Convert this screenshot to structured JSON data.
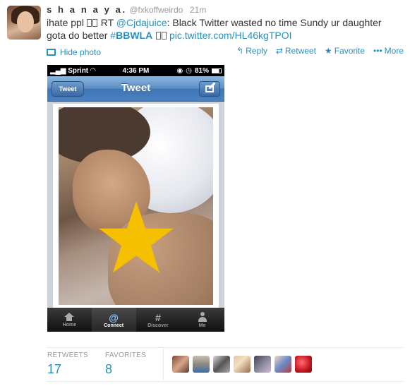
{
  "tweet": {
    "fullname": "s h a n a y a.",
    "handle": "@fxkoffweirdo",
    "time": "21m",
    "text_pre": "ihate ppl",
    "text_rt": "RT",
    "mention": "@Cjdajuice",
    "text_body": ": Black Twitter wasted no time Sundy ur daughter gota do better ",
    "hashtag_prefix": "#",
    "hashtag": "BBWLA",
    "link": "pic.twitter.com/HL46kgTPOI"
  },
  "actions": {
    "hide_photo": "Hide photo",
    "reply": "Reply",
    "retweet": "Retweet",
    "favorite": "Favorite",
    "more": "More"
  },
  "phone": {
    "carrier": "Sprint",
    "time": "4:36 PM",
    "battery": "81%",
    "nav_title": "Tweet",
    "back_label": "Tweet",
    "tabs": [
      {
        "label": "Home",
        "icon": "home-icon"
      },
      {
        "label": "Connect",
        "icon": "at-sign-icon"
      },
      {
        "label": "Discover",
        "icon": "hash-icon"
      },
      {
        "label": "Me",
        "icon": "person-icon"
      }
    ],
    "at_glyph": "@",
    "hash_glyph": "#"
  },
  "stats": {
    "retweets_label": "RETWEETS",
    "retweets_count": "17",
    "favorites_label": "FAVORITES",
    "favorites_count": "8"
  },
  "colors": {
    "link": "#2a8fbd",
    "star": "#f5c000"
  }
}
